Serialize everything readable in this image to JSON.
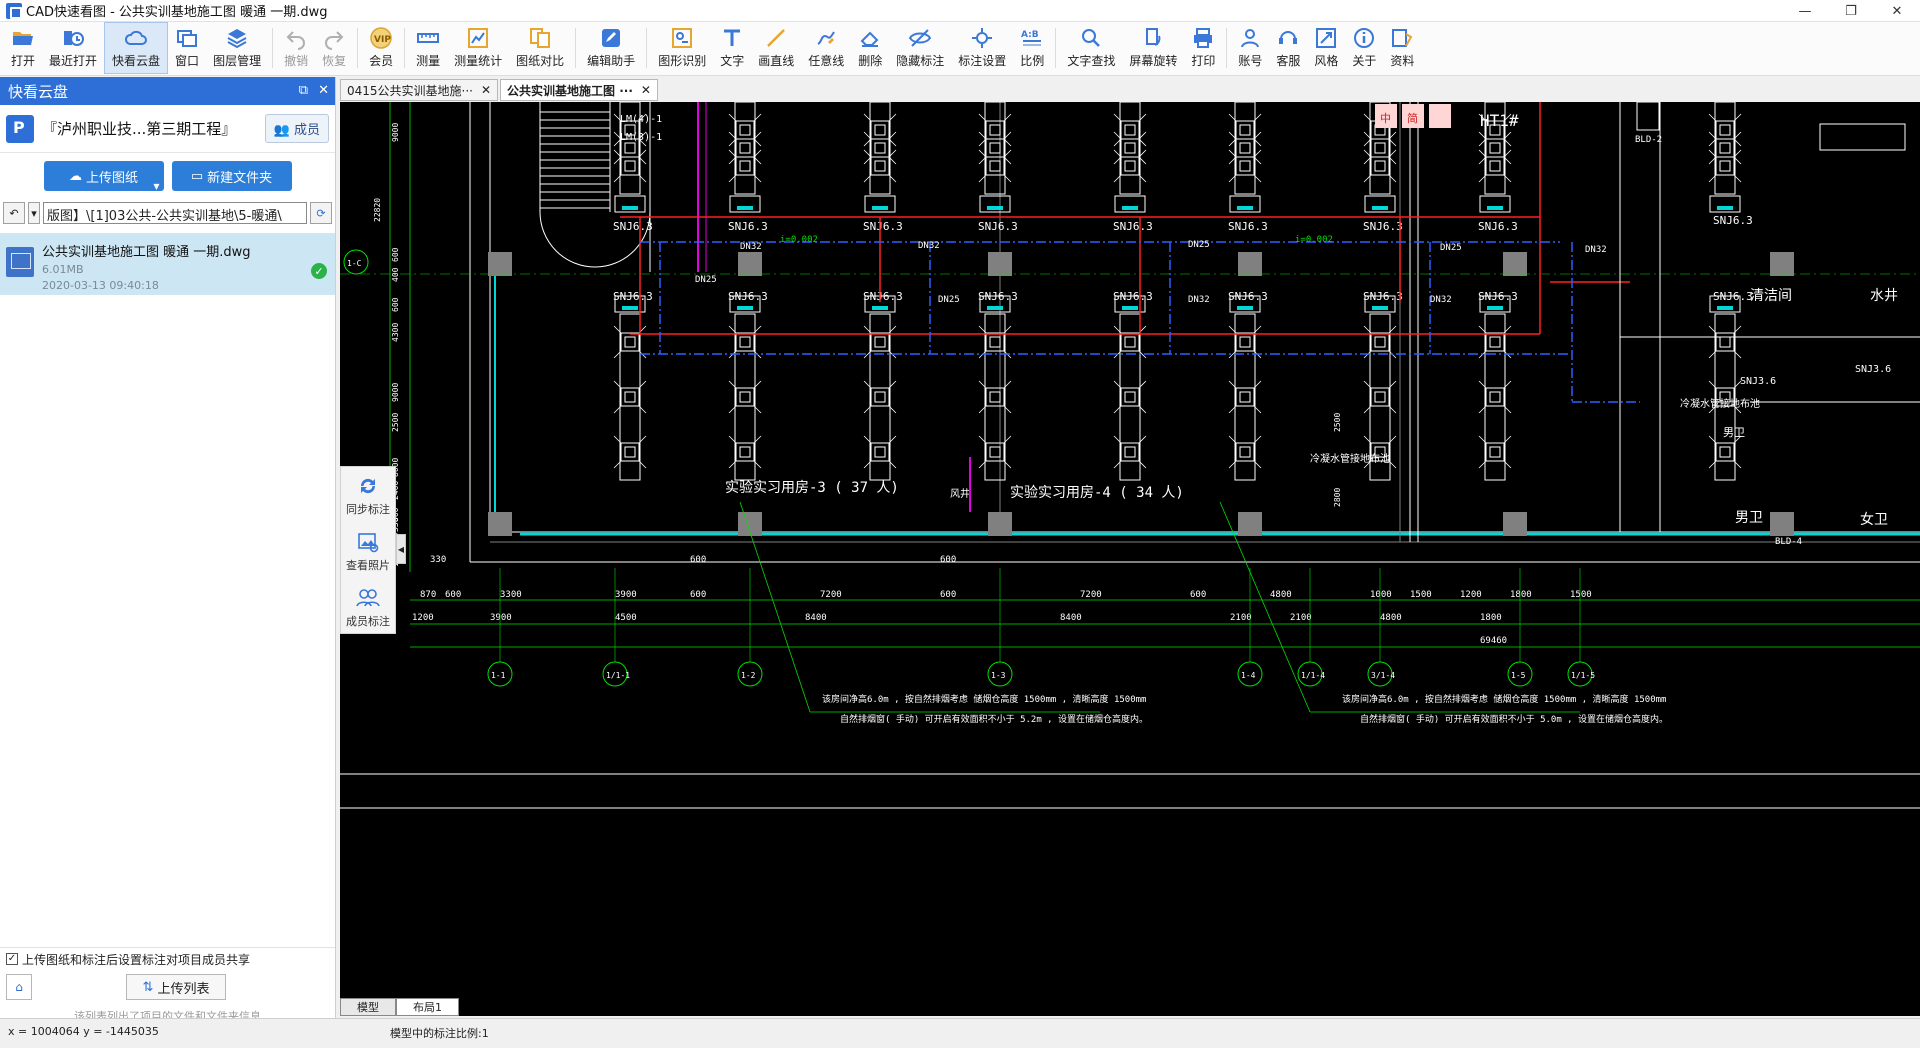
{
  "window": {
    "title": "CAD快速看图 - 公共实训基地施工图 暖通 一期.dwg",
    "controls": [
      "—",
      "❐",
      "✕"
    ]
  },
  "toolbar": {
    "items": [
      {
        "label": "打开",
        "icon": "folder-open-icon"
      },
      {
        "label": "最近打开",
        "icon": "recent-icon"
      },
      {
        "label": "快看云盘",
        "icon": "cloud-icon"
      },
      {
        "label": "窗口",
        "icon": "window-icon"
      },
      {
        "label": "图层管理",
        "icon": "layers-icon"
      },
      {
        "label": "撤销",
        "icon": "undo-icon"
      },
      {
        "label": "恢复",
        "icon": "redo-icon"
      },
      {
        "label": "会员",
        "icon": "vip-icon"
      },
      {
        "label": "测量",
        "icon": "measure-icon"
      },
      {
        "label": "测量统计",
        "icon": "measure-stats-icon"
      },
      {
        "label": "图纸对比",
        "icon": "compare-icon"
      },
      {
        "label": "编辑助手",
        "icon": "edit-assistant-icon"
      },
      {
        "label": "图形识别",
        "icon": "shape-recognize-icon"
      },
      {
        "label": "文字",
        "icon": "text-icon"
      },
      {
        "label": "画直线",
        "icon": "line-icon"
      },
      {
        "label": "任意线",
        "icon": "freehand-icon"
      },
      {
        "label": "删除",
        "icon": "eraser-icon"
      },
      {
        "label": "隐藏标注",
        "icon": "hide-annotation-icon"
      },
      {
        "label": "标注设置",
        "icon": "annotation-settings-icon"
      },
      {
        "label": "比例",
        "icon": "scale-icon"
      },
      {
        "label": "文字查找",
        "icon": "text-search-icon"
      },
      {
        "label": "屏幕旋转",
        "icon": "rotate-screen-icon"
      },
      {
        "label": "打印",
        "icon": "print-icon"
      },
      {
        "label": "账号",
        "icon": "account-icon"
      },
      {
        "label": "客服",
        "icon": "support-icon"
      },
      {
        "label": "风格",
        "icon": "style-icon"
      },
      {
        "label": "关于",
        "icon": "about-icon"
      },
      {
        "label": "资料",
        "icon": "resources-icon"
      }
    ]
  },
  "left_panel": {
    "title": "快看云盘",
    "header_controls": [
      "⧉",
      "✕"
    ],
    "project_name": "『泸州职业技...第三期工程』",
    "member_button": "成员",
    "upload_button": "上传图纸",
    "new_folder_button": "新建文件夹",
    "path": "版图】\\[1]03公共-公共实训基地\\5-暖通\\",
    "file": {
      "name": "公共实训基地施工图 暖通 一期.dwg",
      "size": "6.01MB",
      "date": "2020-03-13 09:40:18"
    },
    "share_checkbox": "上传图纸和标注后设置标注对项目成员共享",
    "upload_list_button": "上传列表",
    "hint": "该列表列出了项目的文件和文件夹信息"
  },
  "side_tools": [
    {
      "label": "同步标注",
      "icon": "sync-annotation-icon"
    },
    {
      "label": "查看照片",
      "icon": "view-photos-icon"
    },
    {
      "label": "成员标注",
      "icon": "member-annotation-icon"
    }
  ],
  "doc_tabs": [
    {
      "label": "0415公共实训基地施···",
      "active": false
    },
    {
      "label": "公共实训基地施工图 ···",
      "active": true
    }
  ],
  "layout_tabs": [
    {
      "label": "模型",
      "active": true
    },
    {
      "label": "布局1",
      "active": false
    }
  ],
  "cad": {
    "unit_label": "SNJ6.3",
    "room3_label": "实验实习用房-3  ( 37 人)",
    "room4_label": "实验实习用房-4  ( 34 人)",
    "pipe_labels": [
      "DN25",
      "DN32",
      "DN25",
      "DN32",
      "DN25",
      "DN32",
      "DN25",
      "DN32",
      "DN32"
    ],
    "slope_label": "i=0.002",
    "riser_labels": [
      "LM(4)-1",
      "LM(3)-1"
    ],
    "right_labels": [
      "清洁间",
      "水井",
      "冷凝水管接地布池",
      "男卫",
      "女卫",
      "BLD-2",
      "BLD-4",
      "风井",
      "冷凝水管接地布池"
    ],
    "right_unit_labels": [
      "SNJ3.6",
      "SNJ3.6"
    ],
    "right_tags": [
      "中",
      "简",
      "HT1#"
    ],
    "grid_bubbles": [
      "1-C",
      "1-1",
      "1/1-1",
      "1-2",
      "1-3",
      "1-4",
      "1/1-4",
      "3/1-4",
      "1-5",
      "1/1-5"
    ],
    "dims_row1": [
      "870",
      "600",
      "3300",
      "3900",
      "600",
      "7200",
      "600",
      "7200",
      "600",
      "4800",
      "1000",
      "1500",
      "1200",
      "1800",
      "1500"
    ],
    "dims_row1_top": [
      "330",
      "600",
      "600"
    ],
    "dims_row2": [
      "1200",
      "3900",
      "4500",
      "8400",
      "8400",
      "2100",
      "2100",
      "4800",
      "1800"
    ],
    "total_dim": "69460",
    "vertical_dims": [
      "9000",
      "22820",
      "600",
      "400",
      "600",
      "4300",
      "9000",
      "8000",
      "2500",
      "2400",
      "600",
      "330",
      "870",
      "1200",
      "2500",
      "2800"
    ],
    "note1_line1": "该房间净高6.0m , 按自然排烟考虑 储烟仓高度 1500mm , 清晰高度 1500mm",
    "note1_line2": "自然排烟窗( 手动) 可开启有效面积不小于 5.2m , 设置在储烟仓高度内。",
    "note2_line1": "该房间净高6.0m , 按自然排烟考虑 储烟仓高度 1500mm , 清晰高度 1500mm",
    "note2_line2": "自然排烟窗( 手动) 可开启有效面积不小于 5.0m , 设置在储烟仓高度内。"
  },
  "status": {
    "coords": "x = 1004064  y = -1445035",
    "scale_text": "模型中的标注比例:1"
  },
  "colors": {
    "brand_blue": "#2d6fd6",
    "cad_background": "#000000",
    "cad_white": "#ffffff",
    "cad_red": "#ff2020",
    "cad_blue": "#2f5fff",
    "cad_green": "#00e000",
    "cad_magenta": "#e000e0",
    "cad_cyan": "#00d8d8",
    "cad_gray": "#808080"
  }
}
